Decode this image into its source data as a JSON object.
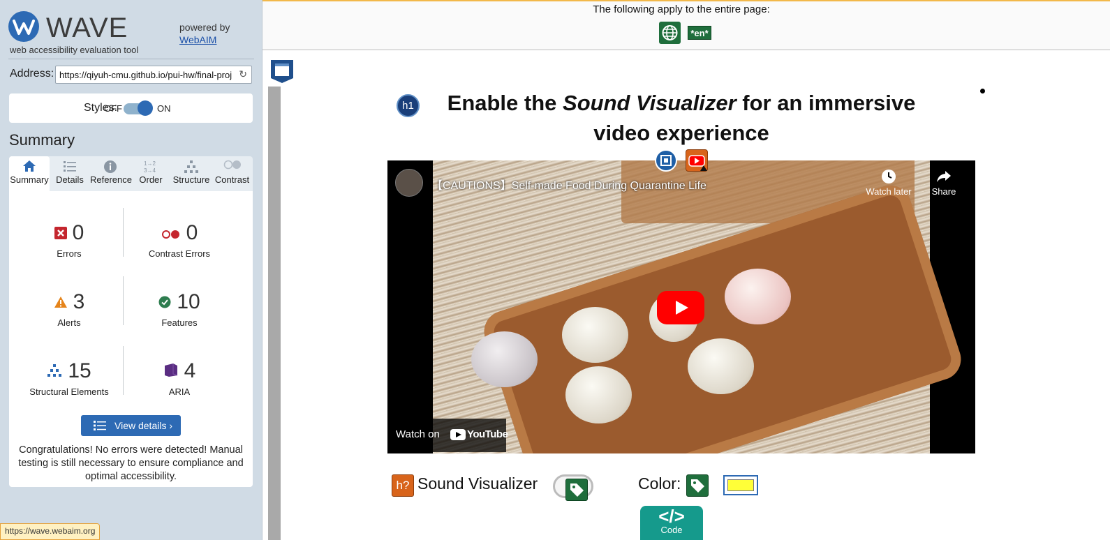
{
  "sidebar": {
    "logo_word": "WAVE",
    "logo_tagline": "web accessibility evaluation tool",
    "powered_by": "powered by",
    "powered_link": "WebAIM",
    "address_label": "Address:",
    "address_value": "https://qiyuh-cmu.github.io/pui-hw/final-proj",
    "styles_label": "Styles:",
    "styles_off": "OFF",
    "styles_on": "ON",
    "summary_title": "Summary",
    "tabs": [
      {
        "label": "Summary",
        "icon": "home-icon"
      },
      {
        "label": "Details",
        "icon": "list-icon"
      },
      {
        "label": "Reference",
        "icon": "info-icon"
      },
      {
        "label": "Order",
        "icon": "order-icon"
      },
      {
        "label": "Structure",
        "icon": "structure-icon"
      },
      {
        "label": "Contrast",
        "icon": "contrast-icon"
      }
    ],
    "stats": {
      "errors": {
        "count": "0",
        "label": "Errors"
      },
      "contrast_errors": {
        "count": "0",
        "label": "Contrast Errors"
      },
      "alerts": {
        "count": "3",
        "label": "Alerts"
      },
      "features": {
        "count": "10",
        "label": "Features"
      },
      "structural": {
        "count": "15",
        "label": "Structural Elements"
      },
      "aria": {
        "count": "4",
        "label": "ARIA"
      }
    },
    "view_details_label": "View details ›",
    "congrats_text": "Congratulations! No errors were detected! Manual testing is still necessary to ensure compliance and optimal accessibility.",
    "status_url": "https://wave.webaim.org"
  },
  "page": {
    "apply_text": "The following apply to the entire page:",
    "lang_badge": "*en*",
    "h1_badge": "h1",
    "heading_pre": "Enable the ",
    "heading_em": "Sound Visualizer",
    "heading_post": " for an immersive video experience",
    "video": {
      "title": "【CAUTIONS】Self-made Food During Quarantine Life",
      "watch_later": "Watch later",
      "share": "Share",
      "watch_on": "Watch on",
      "youtube": "YouTube"
    },
    "h_unknown_badge": "h?",
    "sound_visualizer_label": "Sound Visualizer",
    "color_label": "Color:",
    "color_value": "#ffff38",
    "code_badge_label": "Code"
  },
  "colors": {
    "accent": "#2d6ab4",
    "error": "#c4262e",
    "alert": "#e5841b",
    "feature": "#2e7d4f",
    "aria": "#5a2d82",
    "structure": "#2d6ab4"
  }
}
